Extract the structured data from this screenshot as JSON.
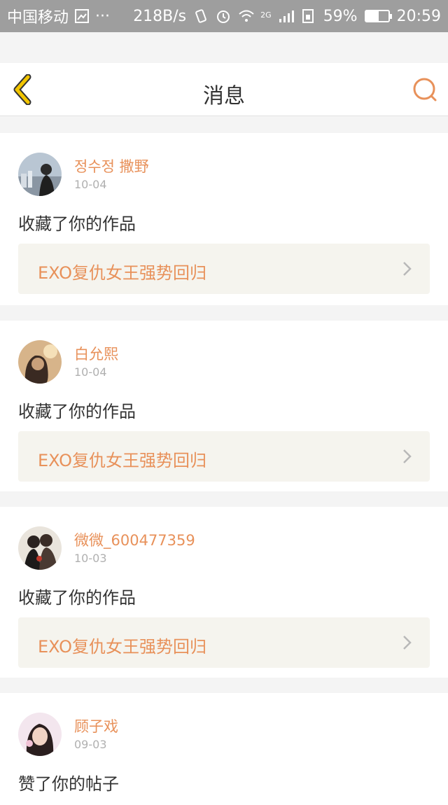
{
  "status_bar": {
    "carrier": "中国移动",
    "dots": "···",
    "net_speed": "218B/s",
    "network_type": "2G",
    "battery_pct": "59%",
    "battery_level": 0.59,
    "time": "20:59"
  },
  "header": {
    "title": "消息"
  },
  "messages": [
    {
      "username": "정수정 撒野",
      "date": "10-04",
      "action": "收藏了你的作品",
      "ref": "EXO复仇女王强势回归"
    },
    {
      "username": "白允熙",
      "date": "10-04",
      "action": "收藏了你的作品",
      "ref": "EXO复仇女王强势回归"
    },
    {
      "username": "微微_600477359",
      "date": "10-03",
      "action": "收藏了你的作品",
      "ref": "EXO复仇女王强势回归"
    },
    {
      "username": "顾子戏",
      "date": "09-03",
      "action": "赞了你的帖子"
    }
  ],
  "colors": {
    "accent": "#e8915a",
    "back_arrow": "#f2c500",
    "status_bar": "#9e9e9e"
  }
}
